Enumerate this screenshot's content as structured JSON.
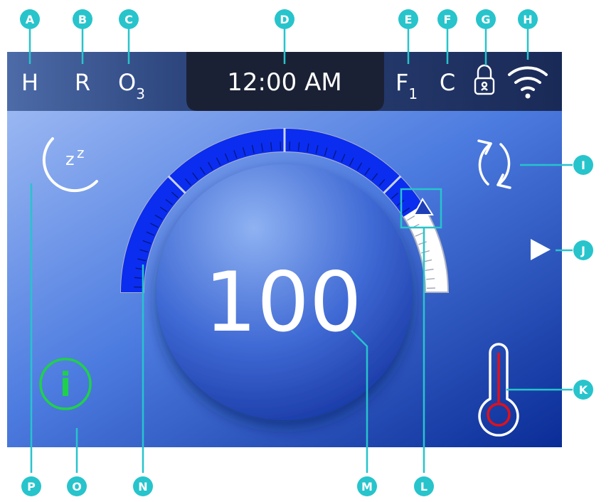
{
  "status_bar": {
    "heat_indicator": "H",
    "rain_indicator": "R",
    "ozone_main": "O",
    "ozone_sub": "3",
    "clock": "12:00 AM",
    "filter_main": "F",
    "filter_sub": "1",
    "unit": "C",
    "lock_icon": "lock-icon",
    "wifi_icon": "wifi-icon"
  },
  "dial": {
    "value": "100",
    "level_percent": 82,
    "marker_icon": "triangle-up-icon",
    "fill_color": "#0a2df0",
    "track_color": "#ffffff"
  },
  "controls": {
    "sleep_icon": "moon-sleep-icon",
    "sleep_z1": "z",
    "sleep_z2": "z",
    "cycle_icon": "refresh-cycle-icon",
    "next_icon": "play-arrow-icon",
    "temperature_icon": "thermometer-icon",
    "info_icon": "info-icon",
    "info_text": "i",
    "info_color": "#1fd14a"
  },
  "callouts": {
    "A": "A",
    "B": "B",
    "C": "C",
    "D": "D",
    "E": "E",
    "F": "F",
    "G": "G",
    "H": "H",
    "I": "I",
    "J": "J",
    "K": "K",
    "L": "L",
    "M": "M",
    "N": "N",
    "O": "O",
    "P": "P"
  },
  "colors": {
    "callout": "#27c4cc",
    "status_bar_left": "#4a6aa8",
    "status_bar_right": "#1c2c5a",
    "clock_bg": "#1b2134",
    "panel_top": "#8fb0f0",
    "panel_bottom": "#0b2f9a",
    "thermometer_mercury": "#e0101a"
  }
}
